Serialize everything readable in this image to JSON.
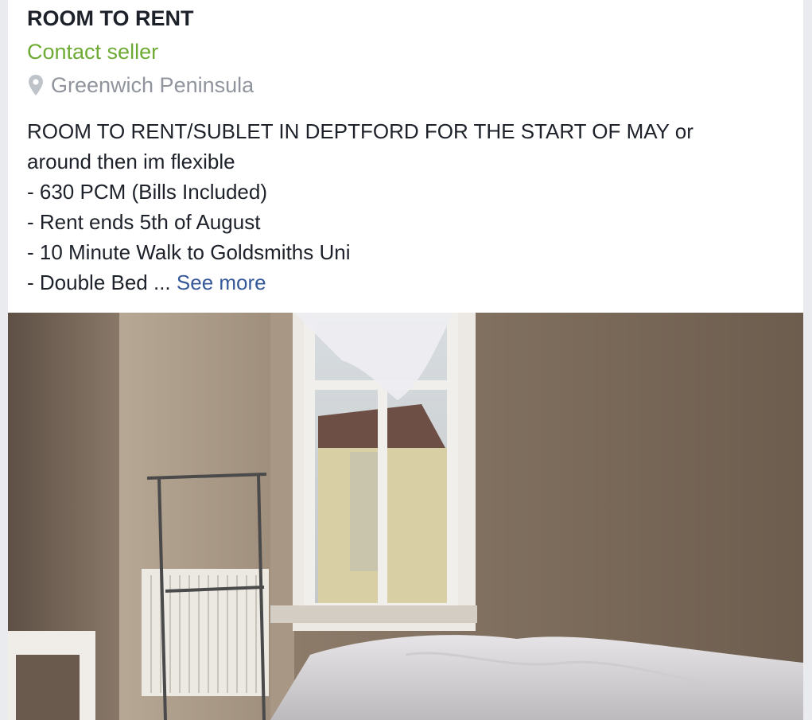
{
  "listing": {
    "title": "ROOM TO RENT",
    "contact_label": "Contact seller",
    "location": "Greenwich Peninsula",
    "description_lines": [
      "ROOM TO RENT/SUBLET IN DEPTFORD FOR THE START OF MAY or",
      "around then im flexible",
      "- 630 PCM (Bills Included)",
      "- Rent ends 5th of August",
      "- 10 Minute Walk to Goldsmiths Uni"
    ],
    "last_line_prefix": "- Double Bed ... ",
    "see_more_label": "See more"
  },
  "icons": {
    "location": "map-pin-icon"
  },
  "colors": {
    "contact": "#6fab34",
    "see_more": "#365899",
    "location_text": "#90949c"
  }
}
